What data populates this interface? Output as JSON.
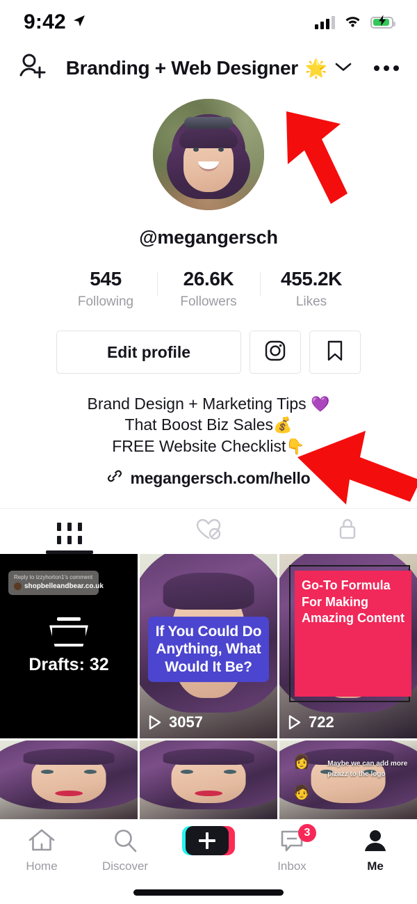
{
  "status_bar": {
    "time": "9:42",
    "location_icon": "location-arrow-icon",
    "signal_icon": "cellular-signal-icon",
    "wifi_icon": "wifi-icon",
    "battery_icon": "battery-charging-icon",
    "battery_color": "#34c759"
  },
  "header": {
    "add_friend_icon": "add-person-icon",
    "title": "Branding + Web Designer",
    "title_emoji": "🌟",
    "chevron_icon": "chevron-down-icon",
    "more_icon": "more-options-icon"
  },
  "profile": {
    "avatar_alt": "profile-photo",
    "handle": "@megangersch",
    "stats": [
      {
        "value": "545",
        "label": "Following"
      },
      {
        "value": "26.6K",
        "label": "Followers"
      },
      {
        "value": "455.2K",
        "label": "Likes"
      }
    ],
    "actions": {
      "edit_label": "Edit profile",
      "instagram_icon": "instagram-icon",
      "bookmark_icon": "bookmark-icon"
    },
    "bio": {
      "line1": "Brand Design + Marketing Tips",
      "line1_emoji": "💜",
      "line2": "That Boost Biz Sales",
      "line2_emoji": "💰",
      "line3": "FREE Website Checklist",
      "line3_emoji": "👇",
      "link_icon": "link-icon",
      "link": "megangersch.com/hello"
    }
  },
  "tabs": [
    {
      "name": "videos-tab",
      "icon": "grid-icon",
      "active": true
    },
    {
      "name": "liked-tab",
      "icon": "heart-slash-icon",
      "active": false
    },
    {
      "name": "private-tab",
      "icon": "lock-icon",
      "active": false
    }
  ],
  "videos": {
    "drafts": {
      "reply_header": "Reply to izzyhorton1's comment",
      "reply_text": "shopbelleandbear.co.uk",
      "icon": "drafts-tray-icon",
      "label": "Drafts: 32"
    },
    "items": [
      {
        "caption": "If You Could Do Anything, What Would It Be?",
        "caption_color": "#4b45cf",
        "views": "3057",
        "play_icon": "play-icon"
      },
      {
        "caption": "Go-To Formula For Making Amazing Content",
        "caption_color": "#f1285a",
        "views": "722",
        "play_icon": "play-icon"
      }
    ],
    "row2": [
      {
        "alt": "video-thumbnail"
      },
      {
        "alt": "video-thumbnail"
      },
      {
        "alt": "video-thumbnail",
        "sticker_line1": "Maybe we can add more",
        "sticker_line2": "pizazz to the logo",
        "emoji1": "👩",
        "emoji2": "🧑"
      }
    ]
  },
  "bottom_nav": [
    {
      "label": "Home",
      "icon": "home-icon",
      "active": false
    },
    {
      "label": "Discover",
      "icon": "search-icon",
      "active": false
    },
    {
      "label": "",
      "icon": "create-video-button",
      "active": false
    },
    {
      "label": "Inbox",
      "icon": "inbox-icon",
      "active": false,
      "badge": "3"
    },
    {
      "label": "Me",
      "icon": "profile-person-icon",
      "active": true
    }
  ],
  "annotations": {
    "arrow1": "red-arrow-pointing-to-profile-name",
    "arrow2": "red-arrow-pointing-to-bio",
    "color": "#f40d0d"
  }
}
